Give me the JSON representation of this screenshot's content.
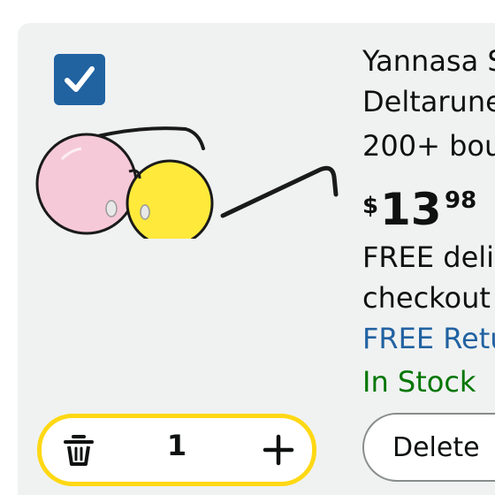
{
  "cart_item": {
    "selected": true,
    "title_lines": [
      "Yannasa S",
      "Deltarune",
      "200+ bou"
    ],
    "price": {
      "symbol": "$",
      "whole": "13",
      "fraction": "98"
    },
    "delivery_lines": [
      "FREE deliv",
      "checkout"
    ],
    "returns_text": "FREE Retu",
    "stock_text": "In Stock",
    "quantity": "1",
    "delete_label": "Delete"
  },
  "icons": {
    "checkbox": "checkmark-icon",
    "trash": "trash-icon",
    "plus": "plus-icon"
  },
  "colors": {
    "checkbox_fill": "#2162a1",
    "stepper_border": "#ffd814",
    "link": "#2162a1",
    "in_stock": "#007600",
    "text": "#0f1111"
  }
}
